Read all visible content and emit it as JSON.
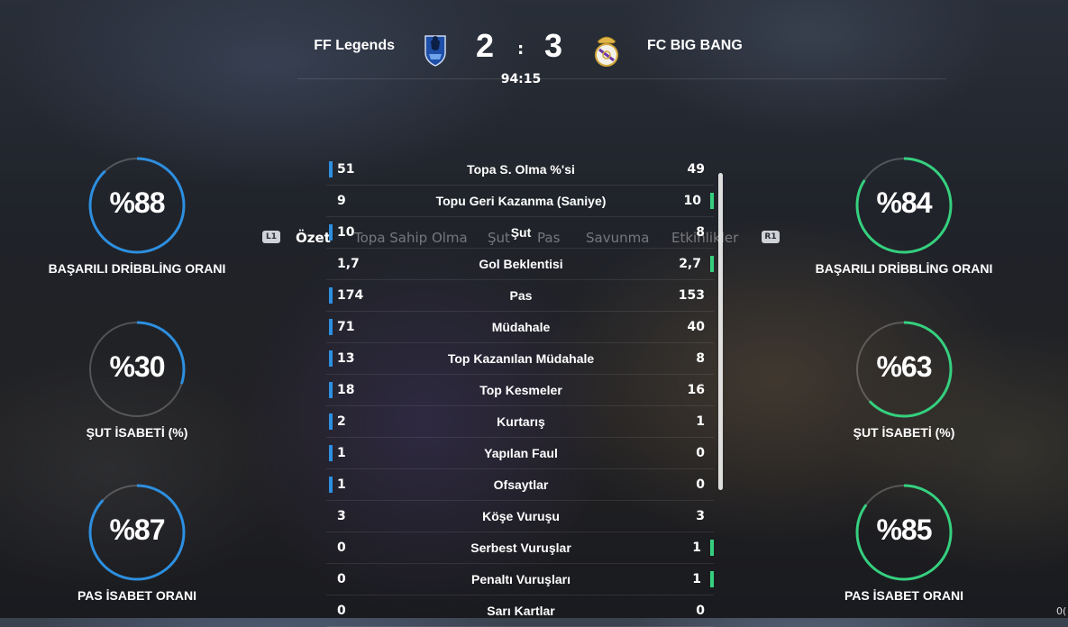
{
  "match": {
    "home_team": "FF Legends",
    "away_team": "FC BIG BANG",
    "home_score": "2",
    "away_score": "3",
    "separator": ":",
    "clock": "94:15",
    "home_crest_icon": "blue-club-crest-icon",
    "away_crest_icon": "real-madrid-crest-icon"
  },
  "tabs": {
    "left_button": "L1",
    "right_button": "R1",
    "items": [
      "Özet",
      "Topa Sahip Olma",
      "Şut",
      "Pas",
      "Savunma",
      "Etkinlikler"
    ],
    "active_index": 0
  },
  "colors": {
    "home_accent": "#2d8fe0",
    "away_accent": "#35d07f"
  },
  "stats": [
    {
      "label": "Topa S. Olma %'si",
      "home": "51",
      "away": "49",
      "leader": "home"
    },
    {
      "label": "Topu Geri Kazanma (Saniye)",
      "home": "9",
      "away": "10",
      "leader": "away"
    },
    {
      "label": "Şut",
      "home": "10",
      "away": "8",
      "leader": "home"
    },
    {
      "label": "Gol Beklentisi",
      "home": "1,7",
      "away": "2,7",
      "leader": "away"
    },
    {
      "label": "Pas",
      "home": "174",
      "away": "153",
      "leader": "home"
    },
    {
      "label": "Müdahale",
      "home": "71",
      "away": "40",
      "leader": "home"
    },
    {
      "label": "Top Kazanılan Müdahale",
      "home": "13",
      "away": "8",
      "leader": "home"
    },
    {
      "label": "Top Kesmeler",
      "home": "18",
      "away": "16",
      "leader": "home"
    },
    {
      "label": "Kurtarış",
      "home": "2",
      "away": "1",
      "leader": "home"
    },
    {
      "label": "Yapılan Faul",
      "home": "1",
      "away": "0",
      "leader": "home"
    },
    {
      "label": "Ofsaytlar",
      "home": "1",
      "away": "0",
      "leader": "home"
    },
    {
      "label": "Köşe Vuruşu",
      "home": "3",
      "away": "3",
      "leader": "none"
    },
    {
      "label": "Serbest Vuruşlar",
      "home": "0",
      "away": "1",
      "leader": "away"
    },
    {
      "label": "Penaltı Vuruşları",
      "home": "0",
      "away": "1",
      "leader": "away"
    },
    {
      "label": "Sarı Kartlar",
      "home": "0",
      "away": "0",
      "leader": "none"
    }
  ],
  "gauges": {
    "home": [
      {
        "text": "%88",
        "percent": 88,
        "label": "BAŞARILI DRİBBLİNG ORANI"
      },
      {
        "text": "%30",
        "percent": 30,
        "label": "ŞUT İSABETİ (%)"
      },
      {
        "text": "%87",
        "percent": 87,
        "label": "PAS İSABET ORANI"
      }
    ],
    "away": [
      {
        "text": "%84",
        "percent": 84,
        "label": "BAŞARILI DRİBBLİNG ORANI"
      },
      {
        "text": "%63",
        "percent": 63,
        "label": "ŞUT İSABETİ (%)"
      },
      {
        "text": "%85",
        "percent": 85,
        "label": "PAS İSABET ORANI"
      }
    ]
  },
  "corner_text": "0("
}
